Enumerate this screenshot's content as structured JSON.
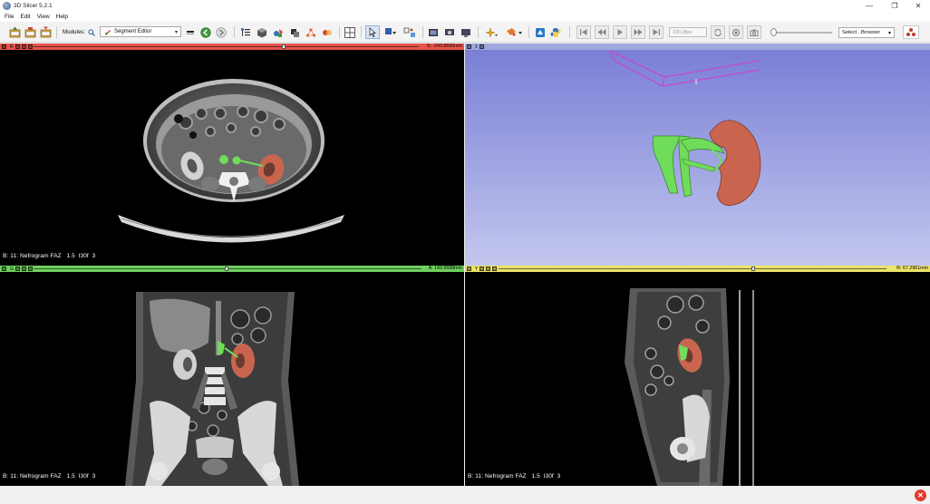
{
  "window": {
    "title": "3D Slicer 5.2.1",
    "min_glyph": "—",
    "max_glyph": "❐",
    "close_glyph": "✕"
  },
  "menubar": {
    "items": [
      "File",
      "Edit",
      "View",
      "Help"
    ]
  },
  "toolbar": {
    "modules_label": "Modules:",
    "current_module": "Segment Editor",
    "fps_value": "100.0fps",
    "browser_select": "Select ..Browser",
    "dropdown_caret": "▾"
  },
  "views": {
    "red": {
      "name": "R",
      "offset": "S: -243.8690mm",
      "color": "#e8554d",
      "slider_position": 0.62,
      "corner_text": "B: 11: Nefrogram FAZ   1.5  I30f  3"
    },
    "threed": {
      "name": "1",
      "color": "#9ea8dc",
      "background_top": "#7a7fd6",
      "background_bottom": "#c3c7ee"
    },
    "green": {
      "name": "G",
      "offset": "A: 143.9598mm",
      "color": "#6fcf5f",
      "slider_position": 0.49,
      "corner_text": "B: 11: Nefrogram FAZ   1.5  I30f  3"
    },
    "yellow": {
      "name": "Y",
      "offset": "R: 67.2961mm",
      "color": "#ece36a",
      "slider_position": 0.65,
      "corner_text": "B: 11: Nefrogram FAZ   1.5  I30f  3"
    }
  },
  "segments": {
    "kidney_color": "#c9654f",
    "vessel_color": "#6fdc5a"
  },
  "status": {
    "error_glyph": "✕"
  }
}
